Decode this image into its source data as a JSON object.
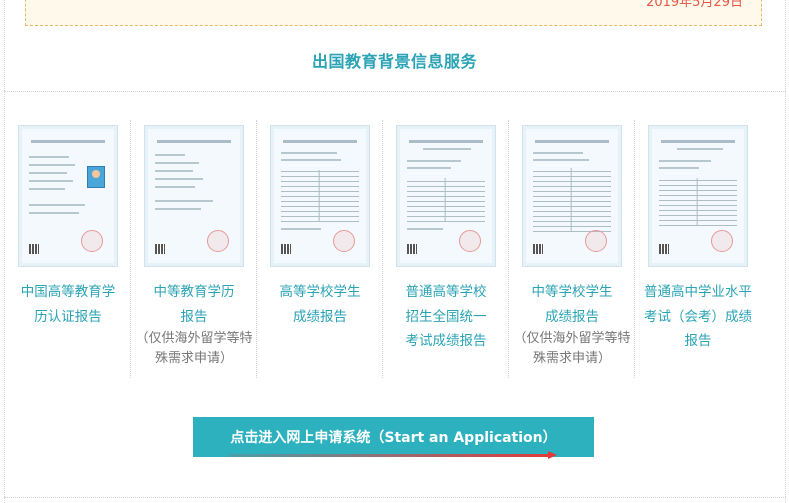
{
  "notice": {
    "date": "2019年5月29日"
  },
  "section_title": "出国教育背景信息服务",
  "cards": [
    {
      "label": "中国高等教育学历认证报告",
      "note": "",
      "icon": "degree-certificate-report-icon"
    },
    {
      "label": "中等教育学历报告",
      "note": "（仅供海外留学等特殊需求申请）",
      "icon": "secondary-education-report-icon"
    },
    {
      "label": "高等学校学生成绩报告",
      "note": "",
      "icon": "university-transcript-report-icon"
    },
    {
      "label": "普通高等学校招生全国统一考试成绩报告",
      "note": "",
      "icon": "gaokao-score-report-icon"
    },
    {
      "label": "中等学校学生成绩报告",
      "note": "（仅供海外留学等特殊需求申请）",
      "icon": "secondary-transcript-report-icon"
    },
    {
      "label": "普通高中学业水平考试（会考）成绩报告",
      "note": "",
      "icon": "huikao-score-report-icon"
    }
  ],
  "apply_button": {
    "label": "点击进入网上申请系统（Start an Application）"
  },
  "colors": {
    "accent": "#2aa3b4",
    "button": "#2eb1bf",
    "arrow": "#e23a3a",
    "note_text": "#777777",
    "date_text": "#e2584a"
  }
}
